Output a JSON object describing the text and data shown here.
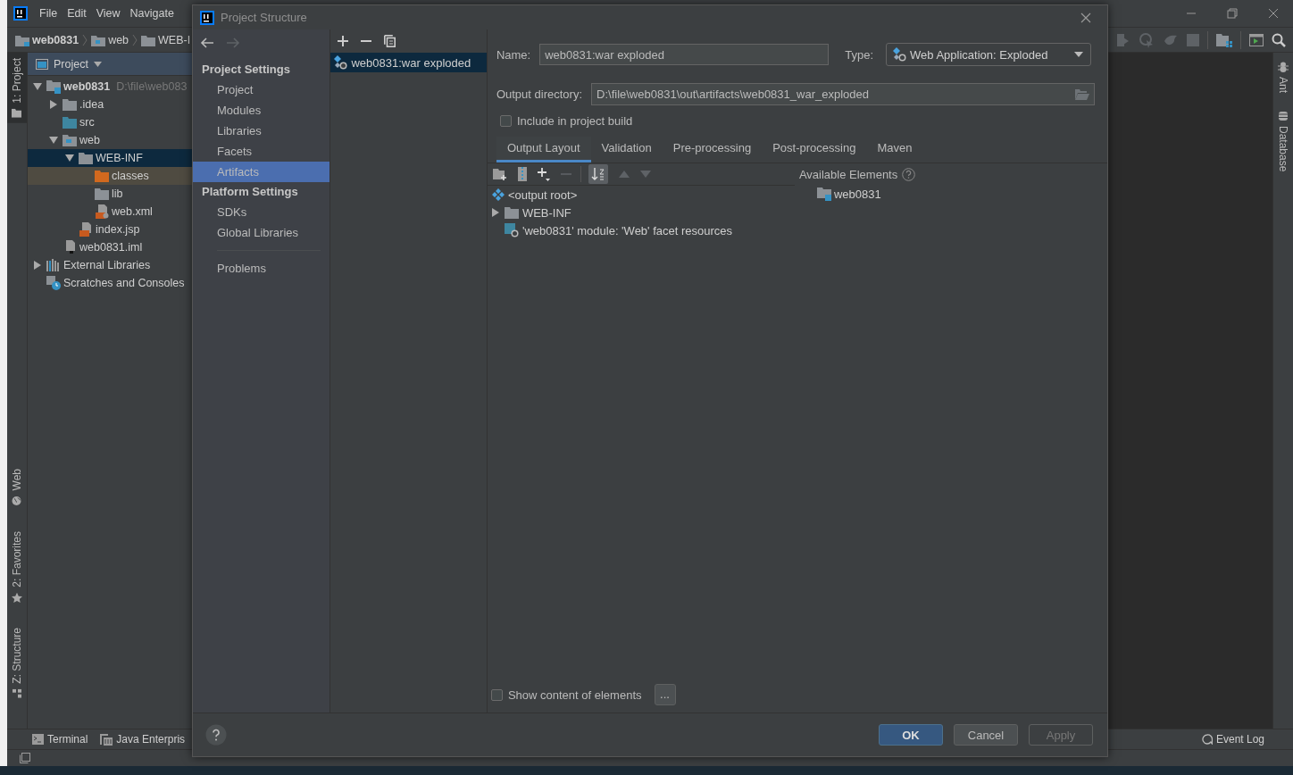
{
  "ide": {
    "menu": [
      "File",
      "Edit",
      "View",
      "Navigate"
    ],
    "breadcrumbs": [
      {
        "label": "web0831",
        "kind": "module"
      },
      {
        "label": "web",
        "kind": "web-folder"
      },
      {
        "label": "WEB-I",
        "kind": "folder"
      }
    ],
    "left_tool_tabs": [
      {
        "label": "1: Project",
        "kind": "project",
        "selected": true
      },
      {
        "label": "Web",
        "kind": "web",
        "selected": false
      },
      {
        "label": "2: Favorites",
        "kind": "favorites",
        "selected": false
      },
      {
        "label": "Z: Structure",
        "kind": "structure",
        "selected": false
      }
    ],
    "project_panel": {
      "title": "Project",
      "tree": [
        {
          "label": "web0831",
          "hint": "D:\\file\\web083",
          "kind": "module",
          "expanded": true,
          "selected": false,
          "marked": false,
          "children": [
            {
              "label": ".idea",
              "kind": "folder",
              "expanded": false,
              "selected": false,
              "marked": false
            },
            {
              "label": "src",
              "kind": "source-folder",
              "selected": false,
              "marked": false
            },
            {
              "label": "web",
              "kind": "web-folder",
              "expanded": true,
              "selected": false,
              "marked": false,
              "children": [
                {
                  "label": "WEB-INF",
                  "kind": "folder",
                  "expanded": true,
                  "selected": true,
                  "marked": false,
                  "children": [
                    {
                      "label": "classes",
                      "kind": "excluded-folder",
                      "selected": false,
                      "marked": true
                    },
                    {
                      "label": "lib",
                      "kind": "folder",
                      "selected": false,
                      "marked": false
                    },
                    {
                      "label": "web.xml",
                      "kind": "xml",
                      "selected": false,
                      "marked": false
                    }
                  ]
                },
                {
                  "label": "index.jsp",
                  "kind": "jsp",
                  "selected": false,
                  "marked": false
                }
              ]
            },
            {
              "label": "web0831.iml",
              "kind": "iml",
              "selected": false,
              "marked": false
            }
          ]
        },
        {
          "label": "External Libraries",
          "kind": "libraries",
          "expanded": false,
          "selected": false,
          "marked": false
        },
        {
          "label": "Scratches and Consoles",
          "kind": "scratches",
          "selected": false,
          "marked": false
        }
      ]
    },
    "right_tool_tabs": [
      {
        "label": "Ant",
        "kind": "ant"
      },
      {
        "label": "Database",
        "kind": "database"
      }
    ],
    "bottom_tool_tabs": [
      {
        "label": "Terminal",
        "kind": "terminal"
      },
      {
        "label": "Java Enterpris",
        "kind": "enterprise"
      }
    ],
    "event_log": "Event Log"
  },
  "dialog": {
    "title": "Project Structure",
    "sidebar": [
      {
        "heading": "Project Settings",
        "items": [
          {
            "label": "Project",
            "selected": false
          },
          {
            "label": "Modules",
            "selected": false
          },
          {
            "label": "Libraries",
            "selected": false
          },
          {
            "label": "Facets",
            "selected": false
          },
          {
            "label": "Artifacts",
            "selected": true
          }
        ]
      },
      {
        "heading": "Platform Settings",
        "items": [
          {
            "label": "SDKs",
            "selected": false
          },
          {
            "label": "Global Libraries",
            "selected": false
          }
        ]
      }
    ],
    "extra_items": [
      {
        "label": "Problems",
        "selected": false
      }
    ],
    "artifacts": [
      {
        "label": "web0831:war exploded",
        "selected": true
      }
    ],
    "name": {
      "label": "Name:",
      "value": "web0831:war exploded"
    },
    "type": {
      "label": "Type:",
      "value": "Web Application: Exploded"
    },
    "output_directory": {
      "label": "Output directory:",
      "value": "D:\\file\\web0831\\out\\artifacts\\web0831_war_exploded"
    },
    "include_in_build": {
      "label": "Include in project build",
      "checked": false
    },
    "tabs": [
      {
        "label": "Output Layout",
        "selected": true
      },
      {
        "label": "Validation",
        "selected": false
      },
      {
        "label": "Pre-processing",
        "selected": false
      },
      {
        "label": "Post-processing",
        "selected": false
      },
      {
        "label": "Maven",
        "selected": false
      }
    ],
    "layout_tree": [
      {
        "kind": "root",
        "label": "<output root>"
      },
      {
        "kind": "folder",
        "label": "WEB-INF",
        "expanded": false
      },
      {
        "kind": "facet",
        "label": "'web0831' module: 'Web' facet resources"
      }
    ],
    "available_elements": {
      "title": "Available Elements",
      "items": [
        {
          "kind": "module",
          "label": "web0831"
        }
      ]
    },
    "show_content": {
      "label": "Show content of elements",
      "checked": false
    },
    "more_button": "...",
    "buttons": [
      {
        "label": "OK",
        "kind": "primary",
        "disabled": false
      },
      {
        "label": "Cancel",
        "kind": "normal",
        "disabled": false
      },
      {
        "label": "Apply",
        "kind": "normal",
        "disabled": true
      }
    ]
  }
}
